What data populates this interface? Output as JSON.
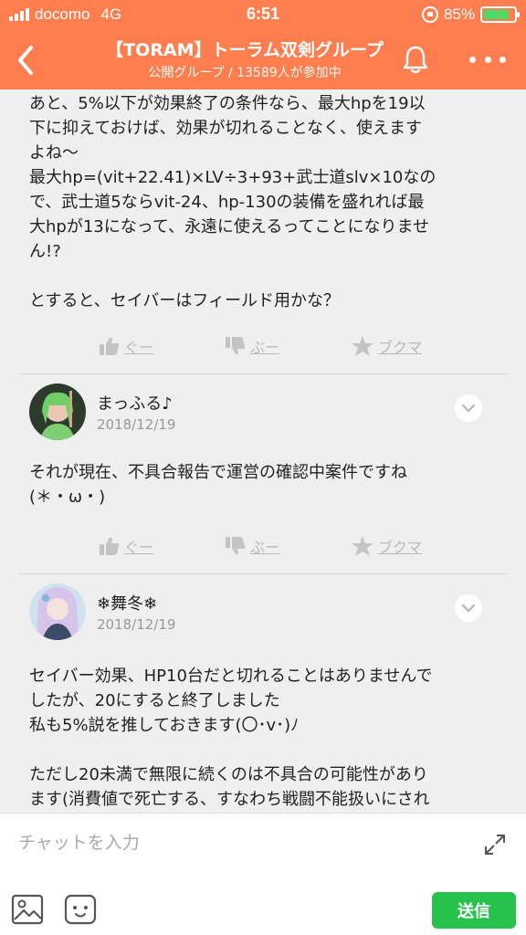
{
  "status_bar": {
    "carrier": "docomo",
    "network": "4G",
    "time": "6:51",
    "battery": "85%",
    "battery_level": 0.85,
    "battery_color": "#4cd964"
  },
  "header": {
    "title": "【TORAM】トーラム双剣グループ",
    "subtitle": "公開グループ / 13589人が参加中",
    "color": "#ff7e4f",
    "icons": [
      "back-icon",
      "bell-icon",
      "more-icon"
    ]
  },
  "messages": [
    {
      "text": "あと、5%以下が効果終了の条件なら、最大hpを19以\n下に抑えておけば、効果が切れることなく、使えます\nよね〜\n最大hp=(vit+22.41)×LV÷3+93+武士道slv×10なの\nで、武士道5ならvit-24、hp-130の装備を盛れれば最\n大hpが13になって、永遠に使えるってことになりませ\nん!?\n\nとすると、セイバーはフィールド用かな？",
      "actions": {
        "good": "ぐー",
        "boo": "ぶー",
        "bookmark": "ブクマ"
      }
    },
    {
      "author": "まっふる♪",
      "date": "2018/12/19",
      "text": "それが現在、不具合報告で運営の確認中案件ですね\n(＊・ω・)",
      "actions": {
        "good": "ぐー",
        "boo": "ぶー",
        "bookmark": "ブクマ"
      }
    },
    {
      "author": "❄舞冬❄",
      "date": "2018/12/19",
      "text": "セイバー効果、HP10台だと切れることはありませんで\nしたが、20にすると終了しました\n私も5%説を推しておきます(〇･v･)ﾉ\n\nただし20未満で無限に続くのは不具合の可能性があり\nます(消費値で死亡する、すなわち戦闘不能扱いにされ\nることがない仕様であれば別です)"
    }
  ],
  "input": {
    "placeholder": "チャットを入力",
    "send_label": "送信",
    "send_color": "#27c24c"
  }
}
